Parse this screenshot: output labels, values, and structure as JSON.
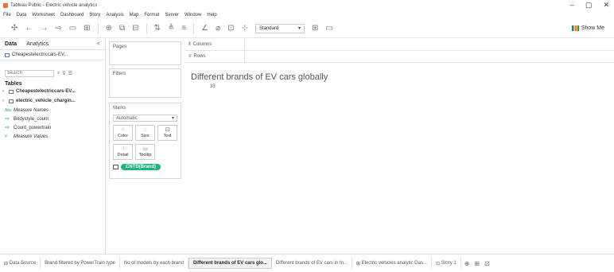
{
  "window": {
    "title": "Tableau Public - Electric vehicle analytics",
    "controls": [
      "–",
      "▢",
      "✕"
    ]
  },
  "menu": [
    "File",
    "Data",
    "Worksheet",
    "Dashboard",
    "Story",
    "Analysis",
    "Map",
    "Format",
    "Server",
    "Window",
    "Help"
  ],
  "toolbar": {
    "fit_select": "Standard",
    "show_me": "Show Me"
  },
  "data_pane": {
    "tabs": [
      "Data",
      "Analytics"
    ],
    "collapse": "<",
    "datasource": "Cheapestelectriccars-EV...",
    "search_placeholder": "Search",
    "tables_heading": "Tables",
    "tables": [
      "Cheapestelectriccars-EV...",
      "electric_vehicle_chargin..."
    ],
    "fields": [
      {
        "type": "Abc",
        "name": "Measure Names"
      },
      {
        "type": "=#",
        "name": "Bodystyle_count"
      },
      {
        "type": "=#",
        "name": "Count_powertrain"
      },
      {
        "type": "#",
        "name": "Measure Values"
      }
    ]
  },
  "cards": {
    "pages": "Pages",
    "filters": "Filters",
    "marks": "Marks",
    "marks_type": "Automatic",
    "mark_buttons": [
      "Color",
      "Size",
      "Text",
      "Detail",
      "Tooltip"
    ],
    "pill": "CNTD(Brand)"
  },
  "shelves": {
    "columns": "Columns",
    "rows": "Rows"
  },
  "viz": {
    "title": "Different brands of EV cars globally",
    "value": "33"
  },
  "tabs": [
    {
      "label": "Data Source",
      "active": false
    },
    {
      "label": "Brand filtered by PowerTrain type",
      "active": false
    },
    {
      "label": "No of models by each brand",
      "active": false
    },
    {
      "label": "Different brands of EV cars glo...",
      "active": true
    },
    {
      "label": "Different brands of EV cars in In...",
      "active": false
    },
    {
      "label": "Electric vehicles analytic Das...",
      "active": false
    },
    {
      "label": "Story 1",
      "active": false
    }
  ]
}
